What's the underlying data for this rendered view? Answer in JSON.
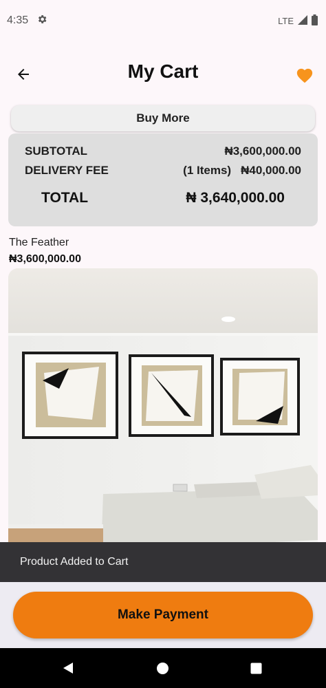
{
  "status_bar": {
    "time": "4:35",
    "network": "LTE",
    "icons": [
      "settings-icon",
      "signal-icon",
      "battery-icon"
    ]
  },
  "header": {
    "title": "My Cart",
    "back_icon": "arrow-left-icon",
    "favorite_icon": "heart-icon"
  },
  "buy_more": {
    "label": "Buy More"
  },
  "summary": {
    "subtotal_label": "SUBTOTAL",
    "subtotal_value": "₦3,600,000.00",
    "delivery_label": "DELIVERY FEE",
    "delivery_items": "(1 Items)",
    "delivery_value": "₦40,000.00",
    "total_label": "TOTAL",
    "total_value": "₦ 3,640,000.00"
  },
  "product": {
    "name": "The Feather",
    "price": "₦3,600,000.00"
  },
  "snackbar": {
    "message": "Product Added to Cart"
  },
  "payment": {
    "label": "Make Payment"
  },
  "nav": {
    "icons": [
      "nav-back-icon",
      "nav-home-icon",
      "nav-recents-icon"
    ]
  },
  "colors": {
    "accent": "#ef7c10",
    "heart": "#f7941d",
    "summary_bg": "#dedede",
    "snackbar_bg": "#333235"
  }
}
